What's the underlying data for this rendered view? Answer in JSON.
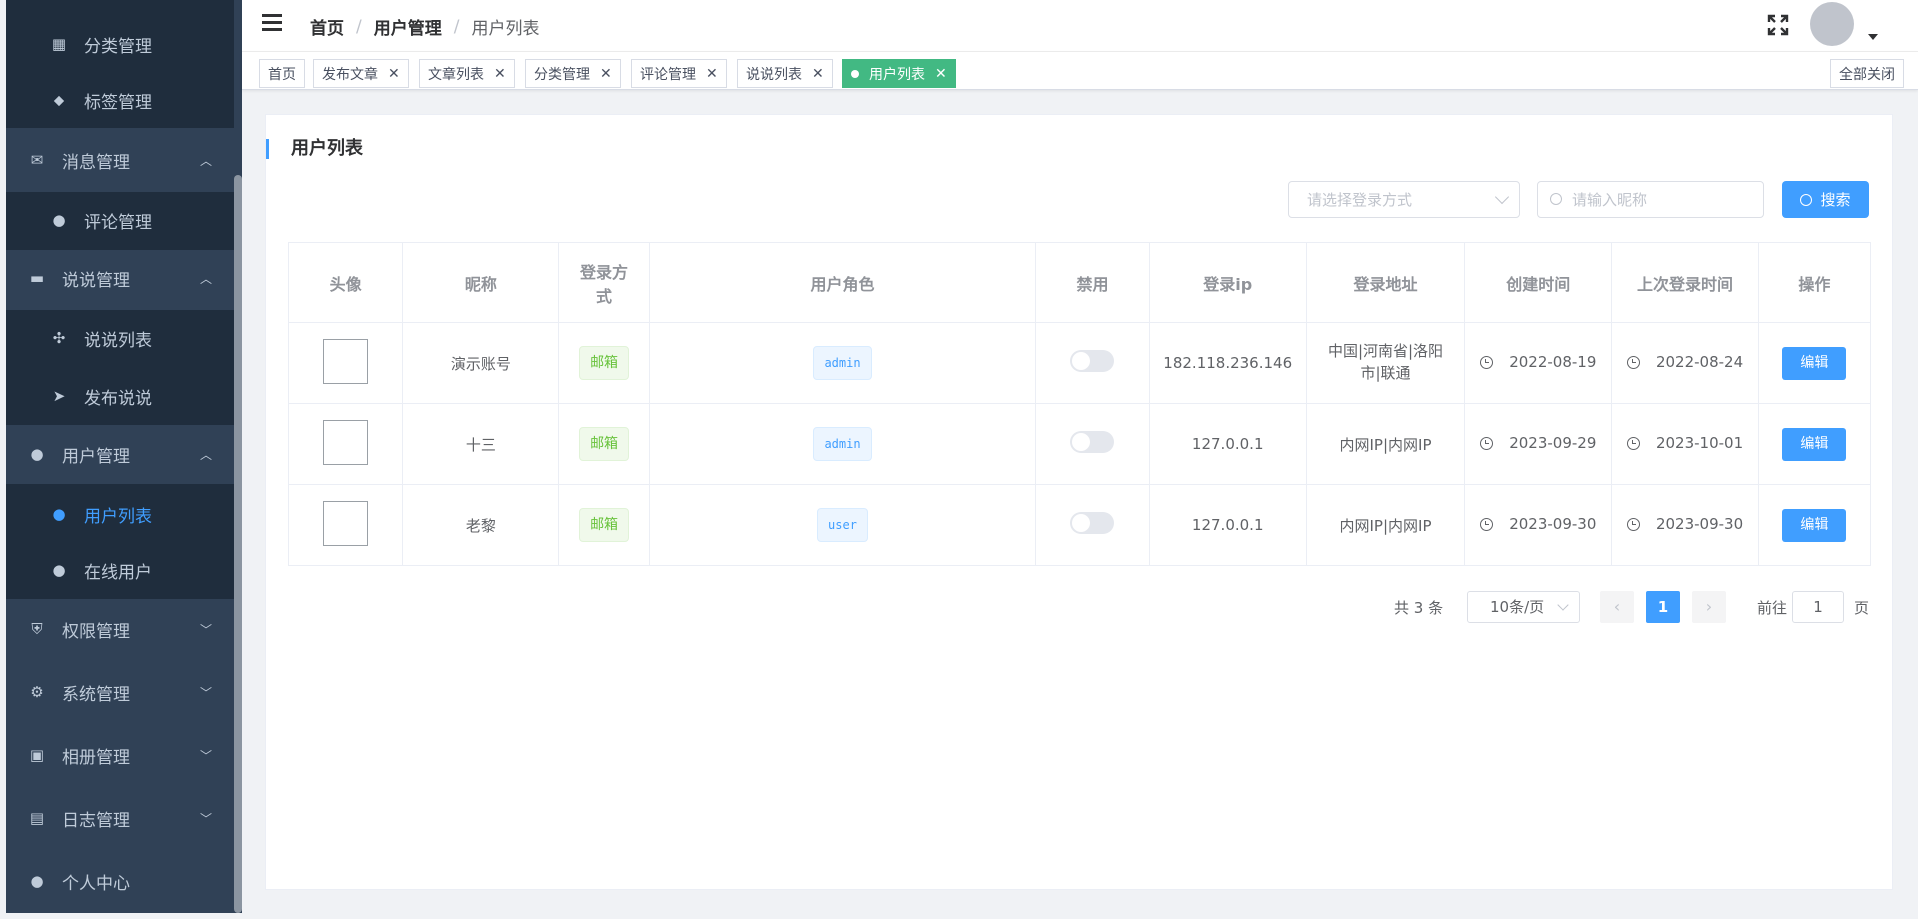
{
  "sidebar": {
    "items": [
      {
        "label": "分类管理",
        "icon": "grid-icon",
        "kind": "sub"
      },
      {
        "label": "标签管理",
        "icon": "tag-icon",
        "kind": "sub"
      },
      {
        "label": "消息管理",
        "icon": "mail-icon",
        "kind": "top",
        "arrow": "up"
      },
      {
        "label": "评论管理",
        "icon": "chat-icon",
        "kind": "sub"
      },
      {
        "label": "说说管理",
        "icon": "message-icon",
        "kind": "top",
        "arrow": "up"
      },
      {
        "label": "说说列表",
        "icon": "pinwheel-icon",
        "kind": "sub"
      },
      {
        "label": "发布说说",
        "icon": "send-icon",
        "kind": "sub"
      },
      {
        "label": "用户管理",
        "icon": "user-icon",
        "kind": "top",
        "arrow": "up"
      },
      {
        "label": "用户列表",
        "icon": "user-icon",
        "kind": "sub",
        "active": true
      },
      {
        "label": "在线用户",
        "icon": "user-icon",
        "kind": "sub"
      },
      {
        "label": "权限管理",
        "icon": "shield-icon",
        "kind": "top",
        "arrow": "down"
      },
      {
        "label": "系统管理",
        "icon": "gear-icon",
        "kind": "top",
        "arrow": "down"
      },
      {
        "label": "相册管理",
        "icon": "picture-icon",
        "kind": "top",
        "arrow": "down"
      },
      {
        "label": "日志管理",
        "icon": "log-icon",
        "kind": "top",
        "arrow": "down"
      },
      {
        "label": "个人中心",
        "icon": "user-icon",
        "kind": "top"
      }
    ]
  },
  "header": {
    "breadcrumb": [
      "首页",
      "用户管理",
      "用户列表"
    ],
    "separator": "/"
  },
  "tags": {
    "items": [
      {
        "label": "首页",
        "closable": false
      },
      {
        "label": "发布文章",
        "closable": true
      },
      {
        "label": "文章列表",
        "closable": true
      },
      {
        "label": "分类管理",
        "closable": true
      },
      {
        "label": "评论管理",
        "closable": true
      },
      {
        "label": "说说列表",
        "closable": true
      },
      {
        "label": "用户列表",
        "closable": true,
        "active": true
      }
    ],
    "close_all": "全部关闭",
    "close_glyph": "✕"
  },
  "main": {
    "title": "用户列表",
    "login_type_placeholder": "请选择登录方式",
    "nickname_placeholder": "请输入昵称",
    "search_label": "搜索",
    "columns": [
      "头像",
      "昵称",
      "登录方式",
      "用户角色",
      "禁用",
      "登录ip",
      "登录地址",
      "创建时间",
      "上次登录时间",
      "操作"
    ],
    "rows": [
      {
        "nickname": "演示账号",
        "login_type": "邮箱",
        "role": "admin",
        "disabled": false,
        "ip": "182.118.236.146",
        "address": "中国|河南省|洛阳市|联通",
        "created": "2022-08-19",
        "last_login": "2022-08-24",
        "action": "编辑"
      },
      {
        "nickname": "十三",
        "login_type": "邮箱",
        "role": "admin",
        "disabled": false,
        "ip": "127.0.0.1",
        "address": "内网IP|内网IP",
        "created": "2023-09-29",
        "last_login": "2023-10-01",
        "action": "编辑"
      },
      {
        "nickname": "老黎",
        "login_type": "邮箱",
        "role": "user",
        "disabled": false,
        "ip": "127.0.0.1",
        "address": "内网IP|内网IP",
        "created": "2023-09-30",
        "last_login": "2023-09-30",
        "action": "编辑"
      }
    ]
  },
  "pagination": {
    "total_text": "共 3 条",
    "page_size": "10条/页",
    "current_page": "1",
    "goto_label": "前往",
    "goto_value": "1",
    "page_suffix": "页"
  },
  "colors": {
    "sidebar_bg": "#304156",
    "sidebar_active_bg": "#1f2d3d",
    "accent": "#409eff",
    "active_tag": "#42b983"
  }
}
